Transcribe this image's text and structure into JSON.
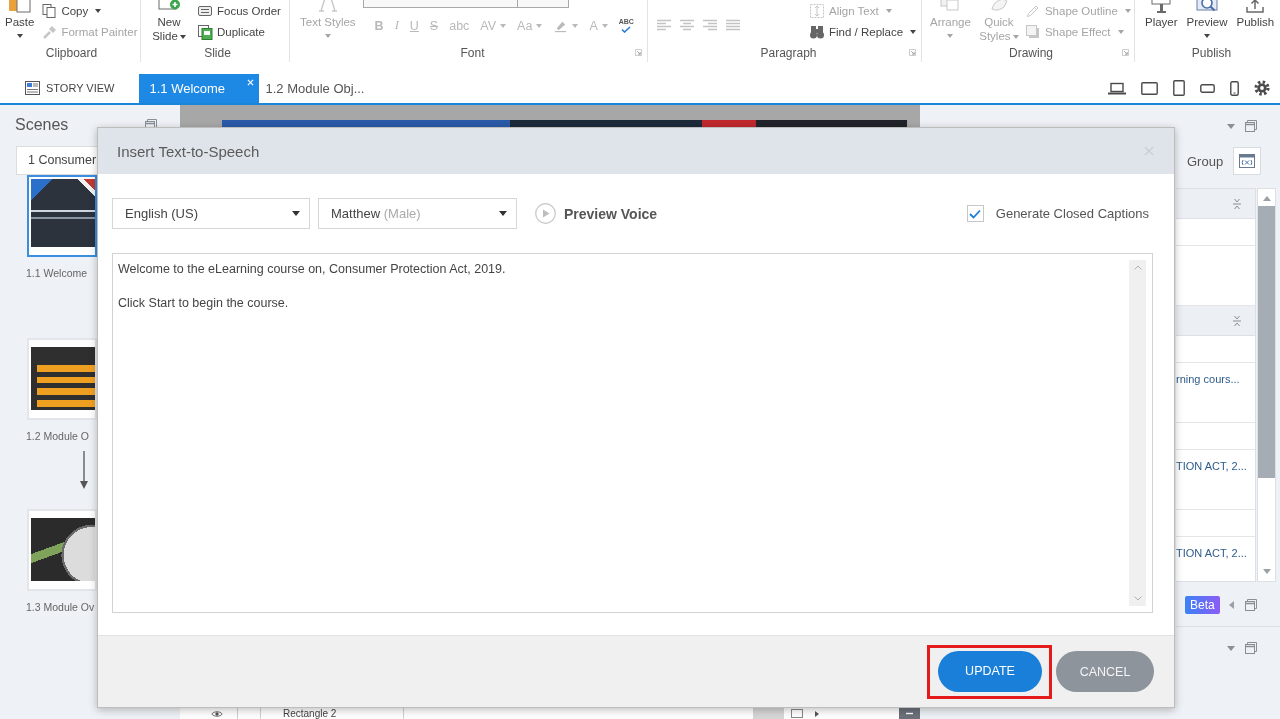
{
  "ribbon": {
    "groups": [
      {
        "label": "Clipboard",
        "launcher": false,
        "items": [
          {
            "kind": "large",
            "label": "Paste",
            "menu": true,
            "disabled": false
          },
          {
            "kind": "small",
            "label": "Copy",
            "menu": true,
            "disabled": false
          },
          {
            "kind": "small",
            "label": "Format Painter",
            "menu": false,
            "disabled": true
          }
        ]
      },
      {
        "label": "Slide",
        "launcher": false,
        "items": [
          {
            "kind": "large",
            "label": "New Slide",
            "menu": true,
            "disabled": false
          },
          {
            "kind": "small",
            "label": "Focus Order",
            "menu": false,
            "disabled": false
          },
          {
            "kind": "small",
            "label": "Duplicate",
            "menu": false,
            "disabled": false
          }
        ]
      },
      {
        "label": "Font",
        "launcher": true,
        "items": [
          {
            "kind": "large",
            "label": "Text Styles",
            "menu": true,
            "disabled": true
          },
          {
            "kind": "format",
            "disabled": true,
            "buttons": [
              {
                "kind": "bold",
                "label": "B",
                "menu": false
              },
              {
                "kind": "italic",
                "label": "I",
                "menu": false
              },
              {
                "kind": "underline",
                "label": "U",
                "menu": false
              },
              {
                "kind": "strike",
                "label": "S",
                "menu": false
              },
              {
                "kind": "plain",
                "label": "abc",
                "menu": false
              },
              {
                "kind": "plain",
                "label": "AV",
                "menu": true
              },
              {
                "kind": "plain",
                "label": "Aa",
                "menu": true
              },
              {
                "kind": "highlighter",
                "menu": true
              },
              {
                "kind": "plain",
                "label": "A",
                "menu": true
              },
              {
                "kind": "spell",
                "label": "ABC",
                "menu": false
              }
            ]
          }
        ]
      },
      {
        "label": "Paragraph",
        "launcher": true,
        "items": [
          {
            "kind": "align",
            "disabled": true
          },
          {
            "kind": "small",
            "label": "Align Text",
            "menu": true,
            "disabled": true
          },
          {
            "kind": "small",
            "label": "Find / Replace",
            "menu": true,
            "disabled": false
          }
        ]
      },
      {
        "label": "Drawing",
        "launcher": true,
        "items": [
          {
            "kind": "large",
            "label": "Arrange",
            "menu": true,
            "disabled": true
          },
          {
            "kind": "large",
            "label": "Quick Styles",
            "menu": true,
            "disabled": true
          },
          {
            "kind": "small",
            "label": "Shape Outline",
            "menu": true,
            "disabled": true
          },
          {
            "kind": "small",
            "label": "Shape Effect",
            "menu": true,
            "disabled": true
          }
        ]
      },
      {
        "label": "Publish",
        "launcher": false,
        "items": [
          {
            "kind": "large",
            "label": "Player",
            "menu": false,
            "disabled": false
          },
          {
            "kind": "large",
            "label": "Preview",
            "menu": true,
            "disabled": false
          },
          {
            "kind": "large",
            "label": "Publish",
            "menu": false,
            "disabled": false
          }
        ]
      }
    ]
  },
  "view_tabs": {
    "story_view": "STORY VIEW",
    "tabs": [
      {
        "label": "1.1 Welcome",
        "selected": true,
        "closable": true
      },
      {
        "label": "1.2 Module Obj...",
        "selected": false,
        "closable": false
      }
    ]
  },
  "scenes_panel": {
    "title": "Scenes",
    "scene": "1 Consumer",
    "slides": [
      {
        "label": "1.1 Welcome",
        "selected": true,
        "links_next": false
      },
      {
        "label": "1.2 Module O",
        "selected": false,
        "links_next": true
      },
      {
        "label": "1.3 Module Ov",
        "selected": false,
        "links_next": false
      }
    ]
  },
  "timeline": {
    "layer": "Rectangle 2"
  },
  "triggers_panel": {
    "group_label": "Group",
    "rows": [
      {
        "kind": "section"
      },
      {
        "kind": "blank"
      },
      {
        "kind": "action"
      },
      {
        "kind": "section"
      },
      {
        "kind": "blank"
      },
      {
        "kind": "action",
        "text": "rning cours..."
      },
      {
        "kind": "blank"
      },
      {
        "kind": "action",
        "text": "TION ACT, 2..."
      },
      {
        "kind": "blank"
      },
      {
        "kind": "action",
        "text": "TION ACT, 2..."
      }
    ],
    "badge": "Beta"
  },
  "dialog": {
    "title": "Insert Text-to-Speech",
    "language": "English (US)",
    "voice": "Matthew",
    "voice_detail": "(Male)",
    "preview": "Preview Voice",
    "captions": {
      "label": "Generate Closed Captions",
      "checked": true
    },
    "text": [
      "Welcome to the eLearning course on, Consumer Protection Act, 2019.",
      "Click Start to begin the course."
    ],
    "buttons": [
      {
        "label": "UPDATE",
        "kind": "primary",
        "highlighted": true
      },
      {
        "label": "CANCEL",
        "kind": "secondary",
        "highlighted": false
      }
    ]
  }
}
